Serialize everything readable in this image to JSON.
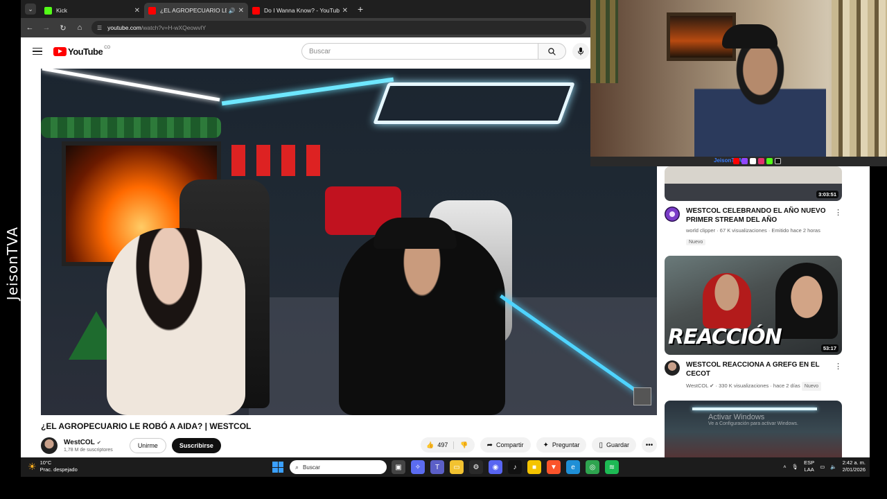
{
  "overlay": {
    "streamer_side_label": "JeisonTVA",
    "webcam_handle": "JeisonTVA"
  },
  "browser": {
    "tabs": [
      {
        "title": "Kick",
        "favicon_color": "#53fc18",
        "active": false
      },
      {
        "title": "¿EL AGROPECUARIO LE ROBÓ",
        "favicon_color": "#ff0000",
        "active": true
      },
      {
        "title": "Do I Wanna Know? - YouTube",
        "favicon_color": "#ff0000",
        "active": false
      }
    ],
    "url_host": "youtube.com",
    "url_path": "/watch?v=H-wXQeowvlY"
  },
  "youtube": {
    "logo_text": "YouTube",
    "logo_country": "CO",
    "search_placeholder": "Buscar"
  },
  "video": {
    "title": "¿EL AGROPECUARIO LE ROBÓ A AIDA? | WESTCOL",
    "channel": "WestCOL",
    "subscribers": "1,78 M de suscriptores",
    "join_label": "Unirme",
    "subscribe_label": "Suscribirse",
    "likes": "497",
    "share_label": "Compartir",
    "ask_label": "Preguntar",
    "save_label": "Guardar"
  },
  "recommendations": [
    {
      "title": "WESTCOL CELEBRANDO EL AÑO NUEVO PRIMER STREAM DEL AÑO",
      "channel": "world clipper",
      "meta": "67 K visualizaciones · Emitido hace 2 horas",
      "badge": "Nuevo",
      "duration": "3:03:51",
      "avatar_color": "#7a3cc8"
    },
    {
      "title": "WESTCOL REACCIONA A GREFG EN EL CECOT",
      "channel": "WestCOL",
      "meta": "330 K visualizaciones · hace 2 días",
      "badge": "Nuevo",
      "duration": "53:17",
      "thumb_text": "REACCIÓN",
      "avatar_color": "#3a2a22"
    },
    {
      "title": "",
      "channel": "",
      "meta": "",
      "badge": "",
      "duration": "",
      "avatar_color": "#444"
    }
  ],
  "windows_watermark": {
    "line1": "Activar Windows",
    "line2": "Ve a Configuración para activar Windows."
  },
  "taskbar": {
    "temperature": "10°C",
    "weather": "Prac. despejado",
    "search_placeholder": "Buscar",
    "lang_line1": "ESP",
    "lang_line2": "LAA",
    "time": "2:42 a. m.",
    "date": "2/01/2026"
  }
}
